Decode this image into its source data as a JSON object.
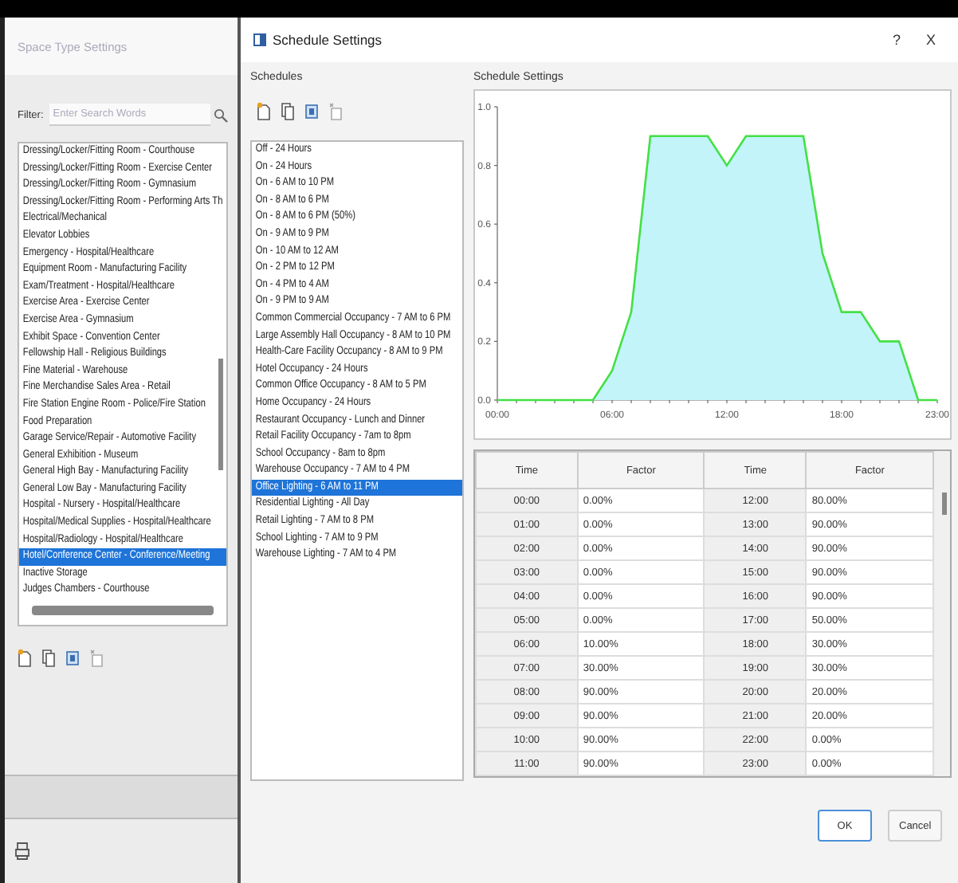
{
  "background_window": {
    "title": "Space Type Settings",
    "filter_label": "Filter:",
    "filter": {
      "placeholder": "Enter Search Words"
    },
    "space_types": [
      {
        "label": "Dressing/Locker/Fitting Room - Courthouse",
        "selected": false
      },
      {
        "label": "Dressing/Locker/Fitting Room - Exercise Center",
        "selected": false
      },
      {
        "label": "Dressing/Locker/Fitting Room - Gymnasium",
        "selected": false
      },
      {
        "label": "Dressing/Locker/Fitting Room - Performing Arts Th",
        "selected": false
      },
      {
        "label": "Electrical/Mechanical",
        "selected": false
      },
      {
        "label": "Elevator Lobbies",
        "selected": false
      },
      {
        "label": "Emergency - Hospital/Healthcare",
        "selected": false
      },
      {
        "label": "Equipment Room - Manufacturing Facility",
        "selected": false
      },
      {
        "label": "Exam/Treatment - Hospital/Healthcare",
        "selected": false
      },
      {
        "label": "Exercise Area - Exercise Center",
        "selected": false
      },
      {
        "label": "Exercise Area - Gymnasium",
        "selected": false
      },
      {
        "label": "Exhibit Space - Convention Center",
        "selected": false
      },
      {
        "label": "Fellowship Hall - Religious Buildings",
        "selected": false
      },
      {
        "label": "Fine Material - Warehouse",
        "selected": false
      },
      {
        "label": "Fine Merchandise Sales Area - Retail",
        "selected": false
      },
      {
        "label": "Fire Station Engine Room - Police/Fire Station",
        "selected": false
      },
      {
        "label": "Food Preparation",
        "selected": false
      },
      {
        "label": "Garage Service/Repair - Automotive Facility",
        "selected": false
      },
      {
        "label": "General Exhibition - Museum",
        "selected": false
      },
      {
        "label": "General High Bay - Manufacturing Facility",
        "selected": false
      },
      {
        "label": "General Low Bay - Manufacturing Facility",
        "selected": false
      },
      {
        "label": "Hospital - Nursery - Hospital/Healthcare",
        "selected": false
      },
      {
        "label": "Hospital/Medical Supplies - Hospital/Healthcare",
        "selected": false
      },
      {
        "label": "Hospital/Radiology - Hospital/Healthcare",
        "selected": false
      },
      {
        "label": "Hotel/Conference Center - Conference/Meeting",
        "selected": true
      },
      {
        "label": "Inactive Storage",
        "selected": false
      },
      {
        "label": "Judges Chambers - Courthouse",
        "selected": false
      }
    ]
  },
  "dialog": {
    "title": "Schedule Settings",
    "help": "?",
    "close": "X"
  },
  "schedules": {
    "label": "Schedules",
    "items": [
      {
        "label": "Off - 24 Hours",
        "selected": false
      },
      {
        "label": "On - 24 Hours",
        "selected": false
      },
      {
        "label": "On - 6 AM to 10 PM",
        "selected": false
      },
      {
        "label": "On - 8 AM to 6 PM",
        "selected": false
      },
      {
        "label": "On - 8 AM to 6 PM (50%)",
        "selected": false
      },
      {
        "label": "On - 9 AM to 9 PM",
        "selected": false
      },
      {
        "label": "On - 10 AM to 12 AM",
        "selected": false
      },
      {
        "label": "On - 2 PM to 12 PM",
        "selected": false
      },
      {
        "label": "On - 4 PM to 4 AM",
        "selected": false
      },
      {
        "label": "On - 9 PM to 9 AM",
        "selected": false
      },
      {
        "label": "Common Commercial Occupancy - 7 AM to 6 PM",
        "selected": false
      },
      {
        "label": "Large Assembly Hall Occupancy - 8 AM to 10 PM",
        "selected": false
      },
      {
        "label": "Health-Care Facility Occupancy - 8 AM to 9 PM",
        "selected": false
      },
      {
        "label": "Hotel Occupancy - 24 Hours",
        "selected": false
      },
      {
        "label": "Common Office Occupancy - 8 AM to 5 PM",
        "selected": false
      },
      {
        "label": "Home Occupancy - 24 Hours",
        "selected": false
      },
      {
        "label": "Restaurant Occupancy - Lunch and Dinner",
        "selected": false
      },
      {
        "label": "Retail Facility Occupancy - 7am to 8pm",
        "selected": false
      },
      {
        "label": "School Occupancy - 8am to 8pm",
        "selected": false
      },
      {
        "label": "Warehouse Occupancy - 7 AM to 4 PM",
        "selected": false
      },
      {
        "label": "Office Lighting - 6 AM to 11 PM",
        "selected": true
      },
      {
        "label": "Residential Lighting - All Day",
        "selected": false
      },
      {
        "label": "Retail Lighting - 7 AM to 8 PM",
        "selected": false
      },
      {
        "label": "School Lighting - 7 AM to 9 PM",
        "selected": false
      },
      {
        "label": "Warehouse Lighting - 7 AM to 4 PM",
        "selected": false
      }
    ]
  },
  "settings": {
    "label": "Schedule Settings",
    "chart_data": {
      "type": "area",
      "x": [
        0,
        1,
        2,
        3,
        4,
        5,
        6,
        7,
        8,
        9,
        10,
        11,
        12,
        13,
        14,
        15,
        16,
        17,
        18,
        19,
        20,
        21,
        22,
        23
      ],
      "series": [
        {
          "color": "#44e044",
          "values": [
            0,
            0,
            0,
            0,
            0,
            0,
            0.1,
            0.3,
            0.9,
            0.9,
            0.9,
            0.9,
            0.8,
            0.9,
            0.9,
            0.9,
            0.9,
            0.5,
            0.3,
            0.3,
            0.2,
            0.2,
            0,
            0
          ]
        }
      ],
      "xlim": [
        0,
        23
      ],
      "ylim": [
        0,
        1
      ],
      "xticks": [
        {
          "value": 0,
          "label": "00:00"
        },
        {
          "value": 6,
          "label": "06:00"
        },
        {
          "value": 12,
          "label": "12:00"
        },
        {
          "value": 18,
          "label": "18:00"
        },
        {
          "value": 23,
          "label": "23:00"
        }
      ],
      "yticks": [
        {
          "value": 0,
          "label": "0.0"
        },
        {
          "value": 0.2,
          "label": "0.2"
        },
        {
          "value": 0.4,
          "label": "0.4"
        },
        {
          "value": 0.6,
          "label": "0.6"
        },
        {
          "value": 0.8,
          "label": "0.8"
        },
        {
          "value": 1,
          "label": "1.0"
        }
      ]
    }
  },
  "table": {
    "columns": [
      "Time",
      "Factor",
      "Time",
      "Factor"
    ],
    "rows": [
      [
        "00:00",
        "0.00%",
        "12:00",
        "80.00%"
      ],
      [
        "01:00",
        "0.00%",
        "13:00",
        "90.00%"
      ],
      [
        "02:00",
        "0.00%",
        "14:00",
        "90.00%"
      ],
      [
        "03:00",
        "0.00%",
        "15:00",
        "90.00%"
      ],
      [
        "04:00",
        "0.00%",
        "16:00",
        "90.00%"
      ],
      [
        "05:00",
        "0.00%",
        "17:00",
        "50.00%"
      ],
      [
        "06:00",
        "10.00%",
        "18:00",
        "30.00%"
      ],
      [
        "07:00",
        "30.00%",
        "19:00",
        "30.00%"
      ],
      [
        "08:00",
        "90.00%",
        "20:00",
        "20.00%"
      ],
      [
        "09:00",
        "90.00%",
        "21:00",
        "20.00%"
      ],
      [
        "10:00",
        "90.00%",
        "22:00",
        "0.00%"
      ],
      [
        "11:00",
        "90.00%",
        "23:00",
        "0.00%"
      ]
    ]
  },
  "buttons": [
    {
      "label": "OK",
      "default": true
    },
    {
      "label": "Cancel",
      "default": false
    }
  ]
}
